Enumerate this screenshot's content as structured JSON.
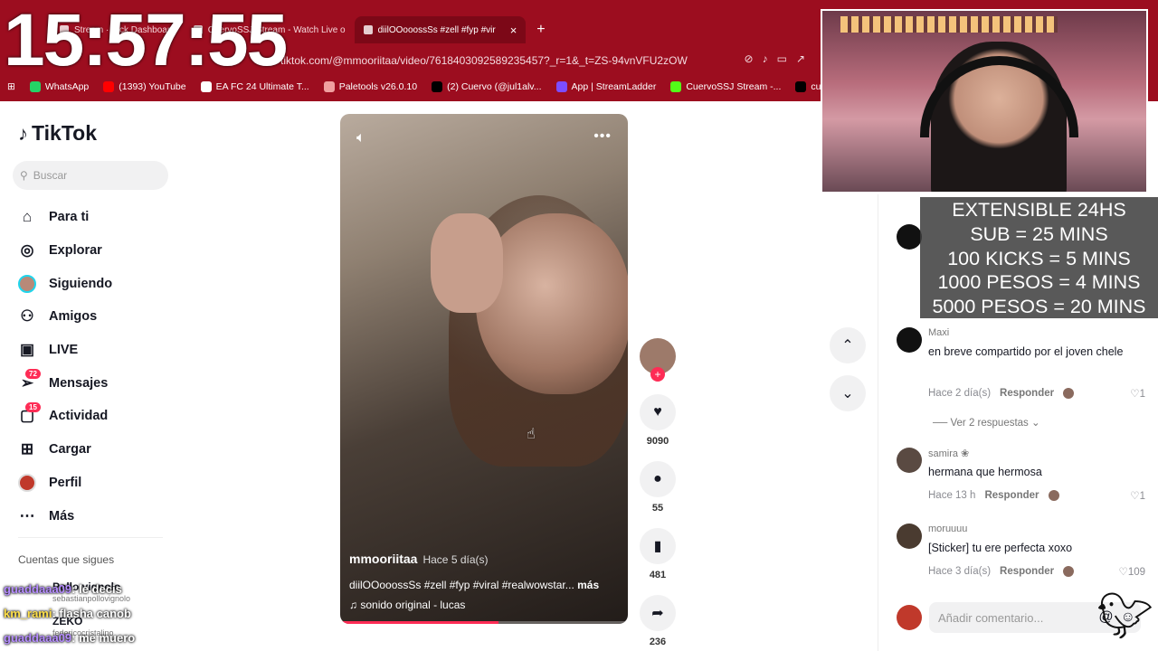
{
  "clock": "15:57:55",
  "browser": {
    "tabs": [
      {
        "label": "Stream · Kick Dashboard",
        "active": false
      },
      {
        "label": "CuervoSSJ Stream - Watch Live o",
        "active": false
      },
      {
        "label": "diilOOooossSs #zell #fyp #vir",
        "active": true
      }
    ],
    "url": "tiktok.com/@mmooriitaa/video/7618403092589235457?_r=1&_t=ZS-94vnVFU2zOW",
    "bookmarks": [
      "WhatsApp",
      "(1393) YouTube",
      "EA FC 24 Ultimate T...",
      "Paletools v26.0.10",
      "(2) Cuervo (@jul1alv...",
      "App | StreamLadder",
      "CuervoSSJ Stream -...",
      "cuer"
    ]
  },
  "sidebar": {
    "logo": "TikTok",
    "search_placeholder": "Buscar",
    "items": [
      {
        "label": "Para ti",
        "icon": "home-icon"
      },
      {
        "label": "Explorar",
        "icon": "compass-icon"
      },
      {
        "label": "Siguiendo",
        "icon": "avatar-icon"
      },
      {
        "label": "Amigos",
        "icon": "friends-icon"
      },
      {
        "label": "LIVE",
        "icon": "live-icon"
      },
      {
        "label": "Mensajes",
        "icon": "messages-icon",
        "badge": "72"
      },
      {
        "label": "Actividad",
        "icon": "activity-icon",
        "badge": "15"
      },
      {
        "label": "Cargar",
        "icon": "upload-icon"
      },
      {
        "label": "Perfil",
        "icon": "profile-icon"
      },
      {
        "label": "Más",
        "icon": "more-icon"
      }
    ],
    "following_title": "Cuentas que sigues"
  },
  "video": {
    "author": "mmooriitaa",
    "age": "Hace 5 día(s)",
    "description": "diilOOooossSs #zell #fyp #viral #realwowstar...",
    "more": "más",
    "sound": "sonido original - lucas",
    "progress": 0.55
  },
  "actions": {
    "likes": "9090",
    "comments": "55",
    "saves": "481",
    "shares": "236"
  },
  "comments": [
    {
      "name": "Maxi",
      "text": "en breve compartido por el joven chele",
      "age": "Hace 2 día(s)",
      "reply": "Responder",
      "likes": "1"
    },
    {
      "name": "samira ❀",
      "text": "hermana que hermosa",
      "age": "Hace 13 h",
      "reply": "Responder",
      "likes": "1"
    },
    {
      "name": "moruuuu",
      "text": "[Sticker] tu ere perfecta xoxo",
      "age": "Hace 3 día(s)",
      "reply": "Responder",
      "likes": "109"
    }
  ],
  "view_replies": "Ver 2 respuestas",
  "add_comment_placeholder": "Añadir comentario...",
  "stream_overlay": {
    "lines": [
      "EXTENSIBLE 24HS",
      "SUB = 25 MINS",
      "100 KICKS = 5 MINS",
      "1000 PESOS = 4 MINS",
      "5000 PESOS = 20 MINS"
    ]
  },
  "chat": [
    {
      "user": "guaddaaa09",
      "message": ": le decis"
    },
    {
      "user": "km_rami",
      "message": ": flasha canob"
    },
    {
      "user": "guaddaaa09",
      "message": ": me muero"
    }
  ],
  "following": [
    {
      "name": "Pollo vignolo",
      "handle": "sebastianpollovignolo"
    },
    {
      "name": "ZEKO",
      "handle": "federicocristalino"
    }
  ],
  "colors": {
    "browser_bar": "#9c0d1f",
    "tiktok_red": "#fe2c55"
  }
}
